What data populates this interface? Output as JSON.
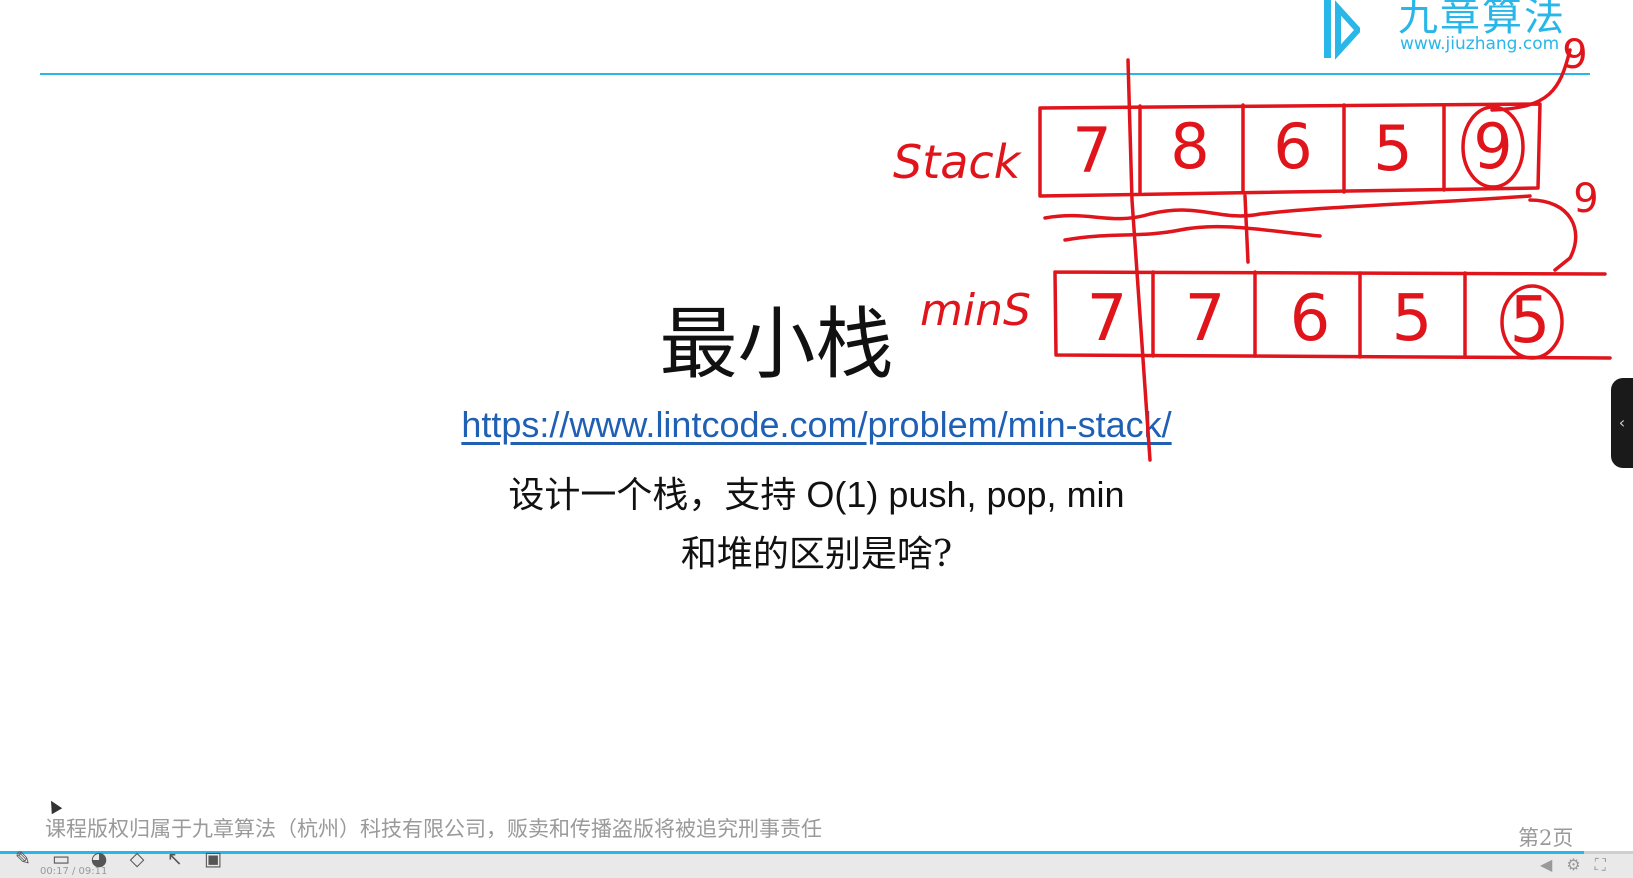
{
  "logo": {
    "name_cn": "九章算法",
    "url": "www.jiuzhang.com"
  },
  "slide": {
    "title": "最小栈",
    "link": "https://www.lintcode.com/problem/min-stack/",
    "description": "设计一个栈，支持 O(1) push, pop, min",
    "question": "和堆的区别是啥?"
  },
  "annotations": {
    "stack_label": "Stack",
    "stack_values": [
      "7",
      "8",
      "6",
      "5",
      "9"
    ],
    "min_label": "minS",
    "min_values": [
      "7",
      "7",
      "6",
      "5",
      "5"
    ],
    "pushed_value": "9"
  },
  "footer": {
    "copyright": "课程版权归属于九章算法（杭州）科技有限公司，贩卖和传播盗版将被追究刑事责任",
    "page_number": "第2页"
  },
  "player": {
    "time": "00:17 / 09:11",
    "progress": 0.97,
    "tools": [
      "pen-icon",
      "screen-icon",
      "palette-icon",
      "eraser-icon",
      "pointer-icon",
      "camera-icon"
    ],
    "side_tab": "‹"
  },
  "colors": {
    "accent": "#29b6e8",
    "ink": "#e0141b",
    "link": "#1f5fb4"
  }
}
